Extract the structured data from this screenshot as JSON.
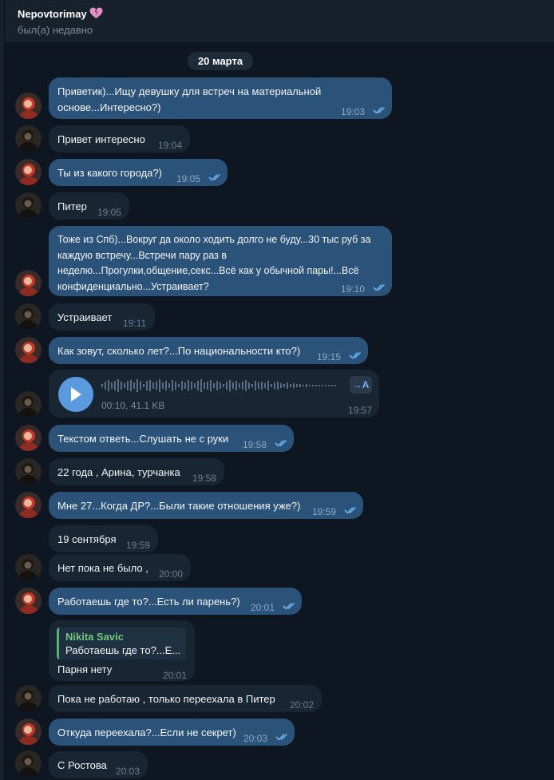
{
  "header": {
    "title": "Nepovtorimay",
    "status": "был(а) недавно"
  },
  "date_separator": "20 марта",
  "colors": {
    "background": "#0e1621",
    "outgoing_bubble": "#2b5278",
    "incoming_bubble": "#182533",
    "accent": "#5a9be0",
    "reply_name": "#72c87f"
  },
  "messages": [
    {
      "text": "Приветик)...Ищу девушку для встреч на материальной основе...Интересно?)",
      "time": "19:03"
    },
    {
      "text": "Привет интересно",
      "time": "19:04"
    },
    {
      "text": "Ты из какого города?)",
      "time": "19:05"
    },
    {
      "text": "Питер",
      "time": "19:05"
    },
    {
      "text": "Тоже из Спб)...Вокруг да около ходить долго не буду...30 тыс руб за каждую встречу...Встречи пару раз в неделю...Прогулки,общение,секс...Всё как у обычной пары!...Всё конфиденциально...Устраивает?",
      "time": "19:10"
    },
    {
      "text": "Устраивает",
      "time": "19:11"
    },
    {
      "text": "Как зовут, сколько лет?...По национальности кто?)",
      "time": "19:15"
    },
    {
      "voice_meta": "00:10, 41.1 KB",
      "transcribe_label": "→A",
      "time": "19:57"
    },
    {
      "text": "Текстом ответь...Слушать не с руки",
      "time": "19:58"
    },
    {
      "text": "22 года , Арина, турчанка",
      "time": "19:58"
    },
    {
      "text": "Мне 27...Когда ДР?...Были такие отношения уже?)",
      "time": "19:59"
    },
    {
      "text": "19 сентября",
      "time": "19:59"
    },
    {
      "text": "Нет пока не было ,",
      "time": "20:00"
    },
    {
      "text": "Работаешь где то?...Есть ли парень?)",
      "time": "20:01"
    },
    {
      "reply_name": "Nikita Savic",
      "reply_text": "Работаешь где то?...Е...",
      "text": "Парня нету",
      "time": "20:01"
    },
    {
      "text": "Пока не работаю , только переехала в Питер",
      "time": "20:02"
    },
    {
      "text": "Откуда переехала?...Если не секрет)",
      "time": "20:03"
    },
    {
      "text": "С Ростова",
      "time": "20:03"
    }
  ]
}
